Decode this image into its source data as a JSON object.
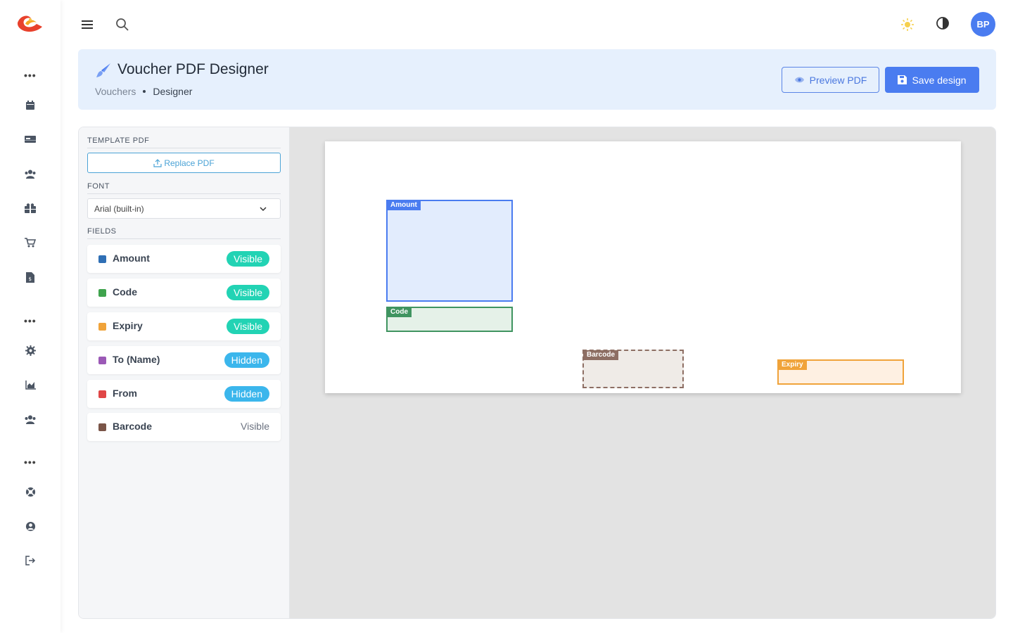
{
  "topbar": {
    "menu_icon": "hamburger-icon",
    "search_icon": "search-icon",
    "theme_icon": "sun-icon",
    "contrast_icon": "contrast-icon",
    "avatar_initials": "BP"
  },
  "sidebar": {
    "logo": "app-logo",
    "items": [
      "calendar-icon",
      "card-icon",
      "users-icon",
      "gift-icon",
      "cart-icon",
      "file-dollar-icon",
      "gear-icon",
      "chart-icon",
      "team-icon",
      "support-icon",
      "account-icon",
      "logout-icon"
    ]
  },
  "header": {
    "title": "Voucher PDF Designer",
    "breadcrumb_parent": "Vouchers",
    "breadcrumb_current": "Designer",
    "preview_label": "Preview PDF",
    "save_label": "Save design"
  },
  "panel": {
    "template_label": "TEMPLATE PDF",
    "replace_label": "Replace PDF",
    "font_label": "FONT",
    "font_value": "Arial (built-in)",
    "fields_label": "FIELDS",
    "fields": [
      {
        "name": "Amount",
        "status": "Visible",
        "color": "#2f6fb5"
      },
      {
        "name": "Code",
        "status": "Visible",
        "color": "#3fa34d"
      },
      {
        "name": "Expiry",
        "status": "Visible",
        "color": "#f0a33a"
      },
      {
        "name": "To (Name)",
        "status": "Hidden",
        "color": "#9b59b6"
      },
      {
        "name": "From",
        "status": "Hidden",
        "color": "#e04646"
      },
      {
        "name": "Barcode",
        "status": "Visible",
        "color": "#7a5548"
      }
    ]
  },
  "canvas": {
    "boxes": {
      "amount": "Amount",
      "code": "Code",
      "barcode": "Barcode",
      "expiry": "Expiry"
    }
  }
}
